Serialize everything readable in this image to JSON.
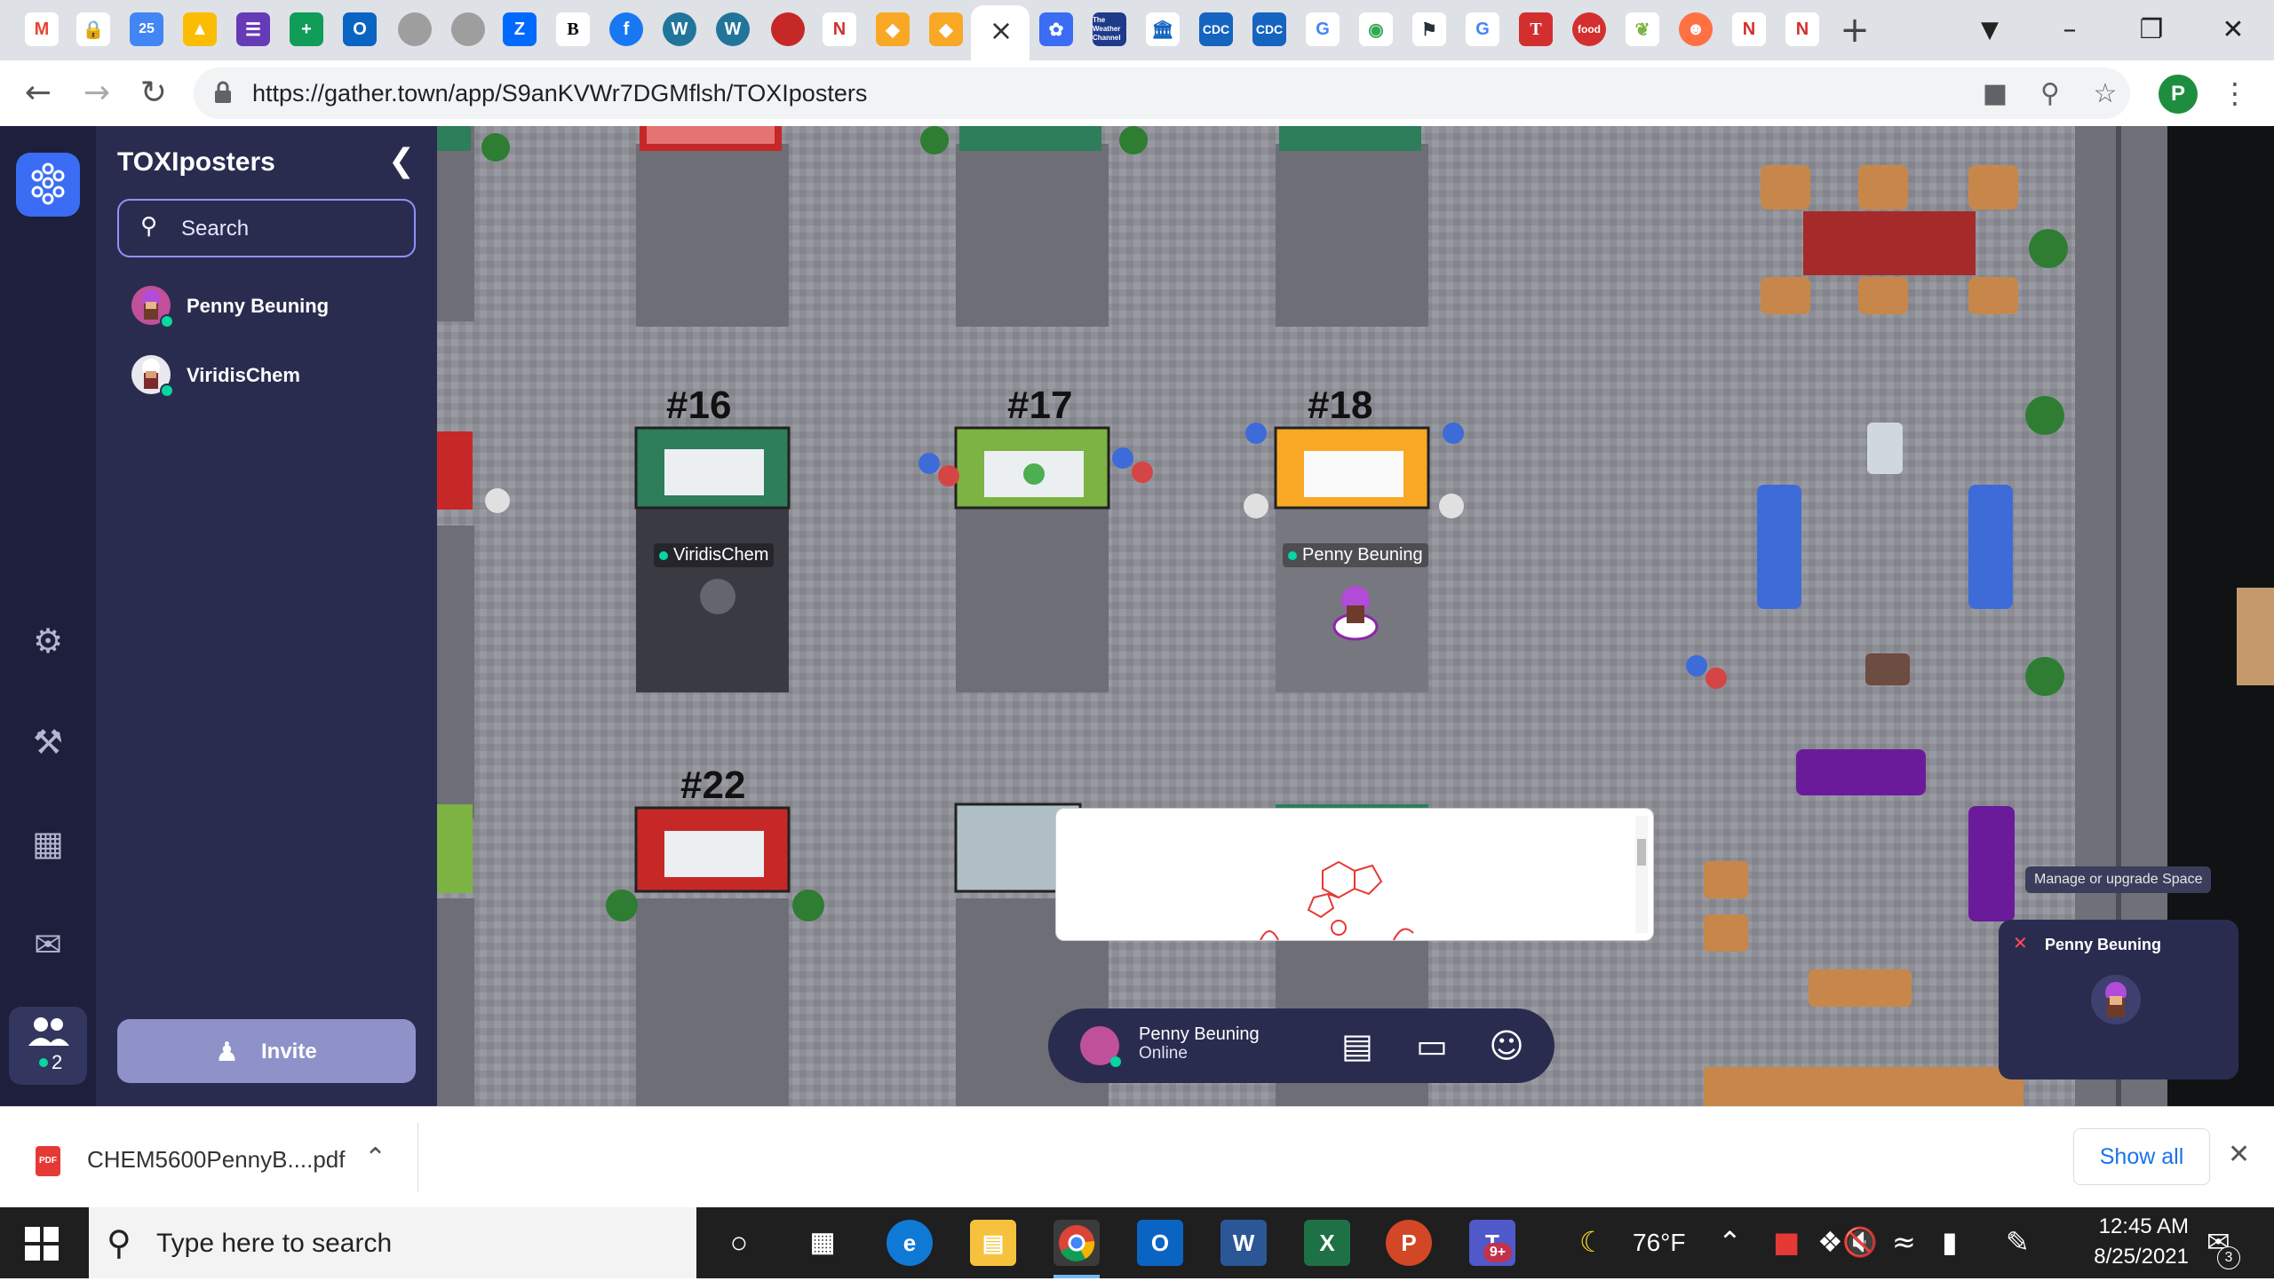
{
  "browser": {
    "url": "https://gather.town/app/S9anKVWr7DGMflsh/TOXIposters",
    "active_tab_close": "×",
    "new_tab": "+",
    "tabs_icons": [
      "gmail-icon",
      "lock-tab-icon",
      "calendar-icon",
      "drive-icon",
      "forms-icon",
      "sheets-icon",
      "outlook-icon",
      "moon-icon",
      "moon2-icon",
      "zillow-icon",
      "bloomberg-icon",
      "facebook-icon",
      "wordpress-icon",
      "wordpress2-icon",
      "apple-icon",
      "netflix-icon",
      "edu-icon",
      "edu2-icon",
      "gather-tab",
      "teams-icon",
      "weather-channel-icon",
      "library-icon",
      "cdc-icon",
      "cdc2-icon",
      "google-icon",
      "chrome-icon",
      "flag-icon",
      "google2-icon",
      "nyt-icon",
      "food-icon",
      "leaf-icon",
      "person-icon",
      "netflix2-icon",
      "netflix3-icon"
    ],
    "weather_tab_text": "The Weather Channel",
    "cdc1": "CDC",
    "cdc2": "CDC",
    "profile_letter": "P",
    "colors": {
      "tabstrip": "#dee1e6",
      "omnibox": "#f1f3f4"
    }
  },
  "gather": {
    "space_title": "TOXIposters",
    "search_placeholder": "Search",
    "members": [
      {
        "name": "Penny Beuning"
      },
      {
        "name": "ViridisChem"
      }
    ],
    "people_count": "2",
    "invite_label": "Invite",
    "map": {
      "posters": [
        {
          "label": "#16"
        },
        {
          "label": "#17"
        },
        {
          "label": "#18"
        },
        {
          "label": "#22"
        }
      ],
      "name_tags": [
        "ViridisChem",
        "Penny Beuning"
      ]
    },
    "bottom_bar": {
      "name": "Penny Beuning",
      "status": "Online"
    },
    "manage_tip": "Manage or upgrade Space",
    "video_tile_name": "Penny Beuning",
    "colors": {
      "rail": "#1d1f3c",
      "panel": "#2a2c4f",
      "accent": "#8e92ff",
      "online": "#06d6a0"
    }
  },
  "downloads": {
    "file_name": "CHEM5600PennyB....pdf",
    "show_all": "Show all"
  },
  "taskbar": {
    "search_placeholder": "Type here to search",
    "weather": "76°F",
    "time": "12:45 AM",
    "date": "8/25/2021",
    "notifications": "3",
    "teams_badge": "9+"
  }
}
